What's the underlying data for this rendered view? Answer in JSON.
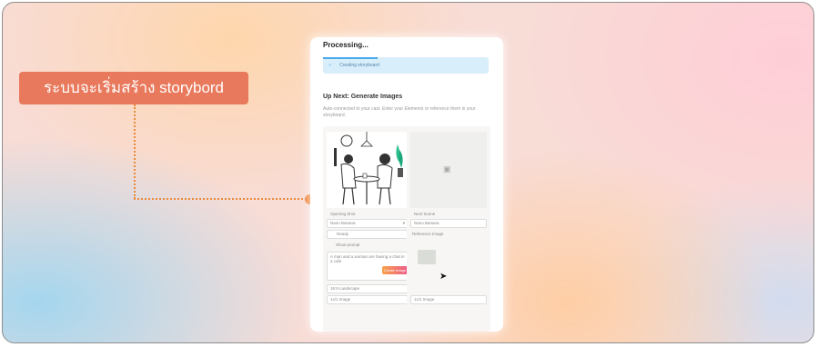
{
  "annotation": {
    "callout_text": "ระบบจะเริ่มสร้าง storybord"
  },
  "dialog": {
    "title": "Processing...",
    "status_text": "Creating storyboard",
    "next_heading": "Up Next: Generate Images",
    "next_description": "Auto-connected to your cast. Enter your Elements or reference them in your storyboard.",
    "left_panel": {
      "frame_label": "Opening Shot",
      "model_select": "Nano Banana",
      "style_label": "Ready",
      "option_label": "Show prompt",
      "prompt_text": "A man and a woman are having a chat in a cafe",
      "generate_button": "Create Image",
      "aspect_select": "16:9 Landscape",
      "count_select": "1x/1 Image"
    },
    "right_panel": {
      "frame_label": "Next Scene",
      "model_select": "Nano Banana",
      "reference_label": "Reference Image",
      "count_select": "1x/1 Image"
    }
  },
  "colors": {
    "callout": "#e9795c",
    "connector": "#ee8134",
    "progress": "#4aa8e8"
  }
}
